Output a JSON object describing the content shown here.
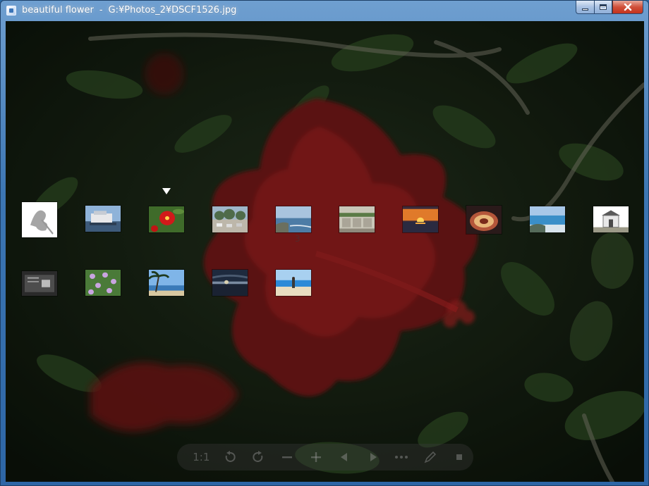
{
  "window": {
    "title_name": "beautiful flower",
    "title_separator": "-",
    "title_path": "G:¥Photos_2¥DSCF1526.jpg"
  },
  "viewer": {
    "current_index": 3,
    "thumbnails": [
      {
        "name": "thumb-flower-sketch",
        "theme": "sketch"
      },
      {
        "name": "thumb-ferry",
        "theme": "ferry"
      },
      {
        "name": "thumb-hibiscus",
        "theme": "hibiscus",
        "selected": true
      },
      {
        "name": "thumb-parking-lot",
        "theme": "lot"
      },
      {
        "name": "thumb-coastline",
        "theme": "coast"
      },
      {
        "name": "thumb-stone-steps",
        "theme": "steps"
      },
      {
        "name": "thumb-sunset",
        "theme": "sunset"
      },
      {
        "name": "thumb-food-plate",
        "theme": "food"
      },
      {
        "name": "thumb-beach-rocks",
        "theme": "beachrocks"
      },
      {
        "name": "thumb-shrine",
        "theme": "shrine"
      },
      {
        "name": "thumb-monument-sign",
        "theme": "sign"
      },
      {
        "name": "thumb-purple-flowers",
        "theme": "purple"
      },
      {
        "name": "thumb-palm-beach",
        "theme": "palm"
      },
      {
        "name": "thumb-dusk-sea",
        "theme": "dusk"
      },
      {
        "name": "thumb-person-beach",
        "theme": "person"
      }
    ]
  },
  "toolbar": {
    "actual_size_label": "1:1",
    "items": [
      {
        "name": "actual-size-button",
        "icon": "text"
      },
      {
        "name": "rotate-left-icon",
        "icon": "rotate-left"
      },
      {
        "name": "rotate-right-icon",
        "icon": "rotate-right"
      },
      {
        "name": "zoom-out-icon",
        "icon": "minus"
      },
      {
        "name": "zoom-in-icon",
        "icon": "plus"
      },
      {
        "name": "previous-icon",
        "icon": "prev"
      },
      {
        "name": "next-icon",
        "icon": "next"
      },
      {
        "name": "more-icon",
        "icon": "dots"
      },
      {
        "name": "edit-icon",
        "icon": "pencil"
      },
      {
        "name": "stop-icon",
        "icon": "stop"
      }
    ]
  },
  "colors": {
    "title_bar": "#3c76b3",
    "close_button": "#c4321c",
    "flower": "#8a1a1a",
    "leaf": "#2d4a22"
  }
}
